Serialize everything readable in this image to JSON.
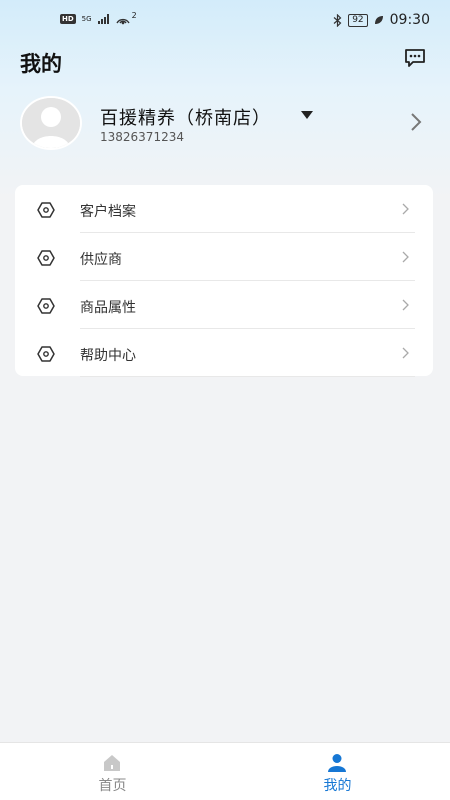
{
  "status_bar": {
    "network": "5G",
    "hotspot_count": "2",
    "hd": "HD",
    "battery": "92",
    "time": "09:30"
  },
  "header": {
    "title": "我的",
    "message_icon": "message-icon"
  },
  "profile": {
    "store_name": "百援精养（桥南店）",
    "phone": "13826371234"
  },
  "menu": {
    "items": [
      {
        "label": "客户档案",
        "icon": "hexagon-icon"
      },
      {
        "label": "供应商",
        "icon": "hexagon-icon"
      },
      {
        "label": "商品属性",
        "icon": "hexagon-icon"
      },
      {
        "label": "帮助中心",
        "icon": "hexagon-icon"
      }
    ]
  },
  "tabbar": {
    "home_label": "首页",
    "mine_label": "我的",
    "active": "我的",
    "active_color": "#1677d4",
    "inactive_color": "#888888"
  }
}
